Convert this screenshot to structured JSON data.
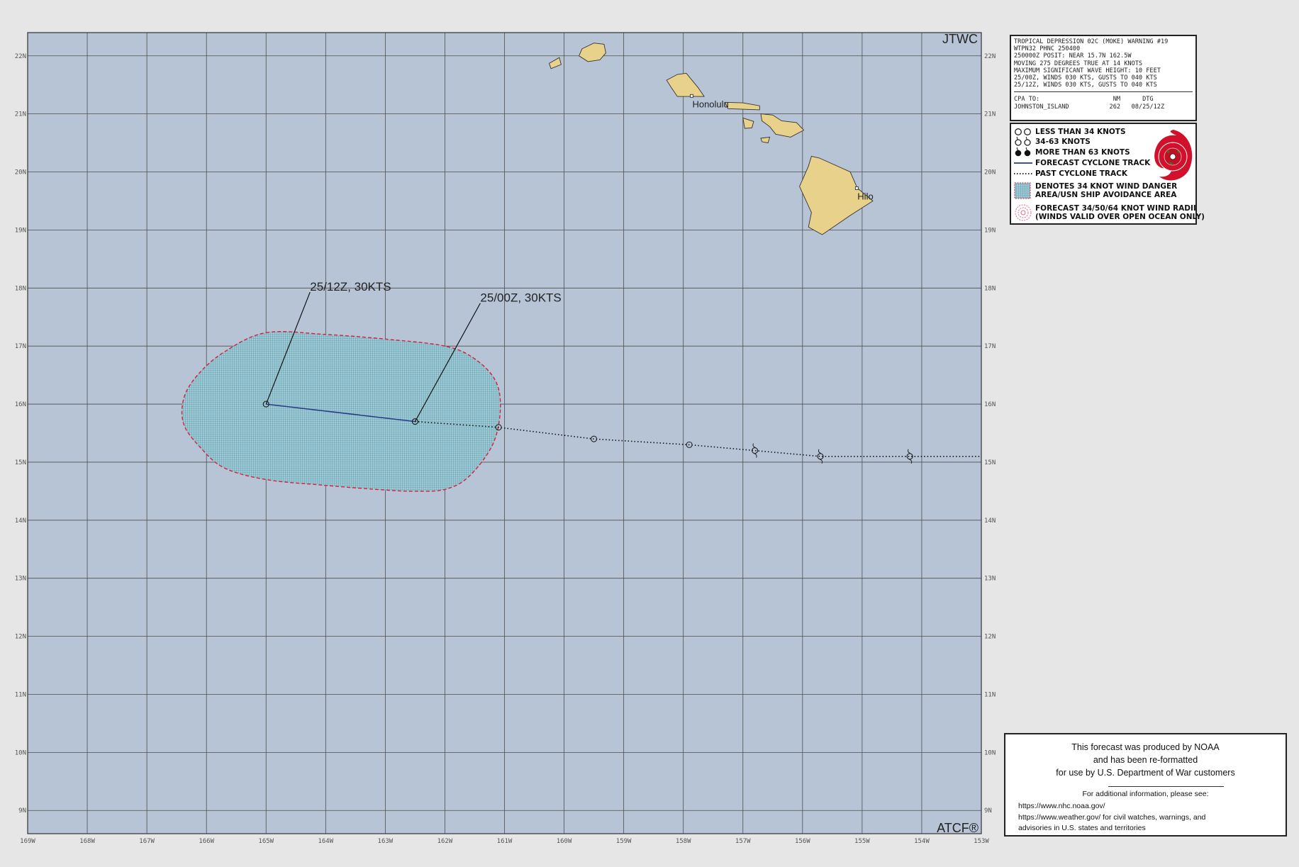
{
  "map": {
    "agency_label": "JTWC",
    "footer_label": "ATCF®",
    "lon_range": [
      -169,
      -153
    ],
    "lat_range": [
      8.6,
      22.4
    ],
    "lon_ticks": [
      "169W",
      "168W",
      "167W",
      "166W",
      "165W",
      "164W",
      "163W",
      "162W",
      "161W",
      "160W",
      "159W",
      "158W",
      "157W",
      "156W",
      "155W",
      "154W",
      "153W"
    ],
    "lat_ticks": [
      "22N",
      "21N",
      "20N",
      "19N",
      "18N",
      "17N",
      "16N",
      "15N",
      "14N",
      "13N",
      "12N",
      "11N",
      "10N",
      "9N"
    ],
    "places": [
      {
        "name": "Honolulu",
        "lon": -157.86,
        "lat": 21.31
      },
      {
        "name": "Hilo",
        "lon": -155.09,
        "lat": 19.72
      }
    ],
    "forecast_track": [
      {
        "label": "25/00Z,  30KTS",
        "lon": -162.5,
        "lat": 15.7
      },
      {
        "label": "25/12Z,  30KTS",
        "lon": -165.0,
        "lat": 16.0
      }
    ],
    "past_track": [
      {
        "lon": -161.1,
        "lat": 15.6,
        "intensity": "less-than-34"
      },
      {
        "lon": -159.5,
        "lat": 15.4,
        "intensity": "less-than-34"
      },
      {
        "lon": -157.9,
        "lat": 15.3,
        "intensity": "less-than-34"
      },
      {
        "lon": -156.8,
        "lat": 15.2,
        "intensity": "34-63"
      },
      {
        "lon": -155.7,
        "lat": 15.1,
        "intensity": "34-63"
      },
      {
        "lon": -154.2,
        "lat": 15.1,
        "intensity": "34-63"
      },
      {
        "lon": -153.0,
        "lat": 15.1,
        "intensity": "34-63"
      }
    ],
    "danger_area": [
      [
        -165.0,
        17.23
      ],
      [
        -164.0,
        17.2
      ],
      [
        -163.0,
        17.12
      ],
      [
        -162.0,
        17.0
      ],
      [
        -161.5,
        16.78
      ],
      [
        -161.15,
        16.4
      ],
      [
        -161.07,
        15.9
      ],
      [
        -161.2,
        15.3
      ],
      [
        -161.6,
        14.75
      ],
      [
        -162.0,
        14.53
      ],
      [
        -162.5,
        14.5
      ],
      [
        -163.0,
        14.52
      ],
      [
        -164.0,
        14.6
      ],
      [
        -165.0,
        14.7
      ],
      [
        -165.7,
        14.9
      ],
      [
        -166.1,
        15.25
      ],
      [
        -166.38,
        15.65
      ],
      [
        -166.38,
        16.1
      ],
      [
        -166.15,
        16.5
      ],
      [
        -165.7,
        16.9
      ]
    ],
    "islands": [
      {
        "name": "Niihau",
        "coords": [
          [
            -160.25,
            21.87
          ],
          [
            -160.08,
            21.97
          ],
          [
            -160.05,
            21.85
          ],
          [
            -160.22,
            21.78
          ]
        ]
      },
      {
        "name": "Kauai",
        "coords": [
          [
            -159.7,
            22.12
          ],
          [
            -159.5,
            22.22
          ],
          [
            -159.33,
            22.2
          ],
          [
            -159.3,
            22.05
          ],
          [
            -159.4,
            21.93
          ],
          [
            -159.6,
            21.9
          ],
          [
            -159.75,
            22.0
          ]
        ]
      },
      {
        "name": "Oahu",
        "coords": [
          [
            -158.28,
            21.58
          ],
          [
            -158.1,
            21.68
          ],
          [
            -157.95,
            21.7
          ],
          [
            -157.75,
            21.45
          ],
          [
            -157.65,
            21.3
          ],
          [
            -158.1,
            21.3
          ],
          [
            -158.2,
            21.45
          ]
        ]
      },
      {
        "name": "Molokai",
        "coords": [
          [
            -157.3,
            21.2
          ],
          [
            -157.0,
            21.19
          ],
          [
            -156.72,
            21.14
          ],
          [
            -156.72,
            21.07
          ],
          [
            -157.25,
            21.09
          ]
        ]
      },
      {
        "name": "Lanai",
        "coords": [
          [
            -157.0,
            20.93
          ],
          [
            -156.82,
            20.87
          ],
          [
            -156.85,
            20.76
          ],
          [
            -156.97,
            20.75
          ]
        ]
      },
      {
        "name": "Maui",
        "coords": [
          [
            -156.7,
            21.0
          ],
          [
            -156.5,
            20.98
          ],
          [
            -156.35,
            20.88
          ],
          [
            -156.1,
            20.85
          ],
          [
            -155.98,
            20.72
          ],
          [
            -156.2,
            20.6
          ],
          [
            -156.45,
            20.65
          ],
          [
            -156.55,
            20.78
          ],
          [
            -156.68,
            20.88
          ]
        ]
      },
      {
        "name": "Kahoolawe",
        "coords": [
          [
            -156.7,
            20.58
          ],
          [
            -156.55,
            20.6
          ],
          [
            -156.58,
            20.5
          ],
          [
            -156.68,
            20.52
          ]
        ]
      },
      {
        "name": "Hawaii",
        "coords": [
          [
            -155.85,
            20.27
          ],
          [
            -155.72,
            20.24
          ],
          [
            -155.2,
            20.0
          ],
          [
            -155.08,
            19.72
          ],
          [
            -154.82,
            19.5
          ],
          [
            -155.2,
            19.25
          ],
          [
            -155.67,
            18.92
          ],
          [
            -155.9,
            19.05
          ],
          [
            -155.85,
            19.3
          ],
          [
            -156.05,
            19.75
          ],
          [
            -155.9,
            20.1
          ]
        ]
      }
    ]
  },
  "colors": {
    "ocean": "#b6c4d6",
    "grid": "#4d4d4d",
    "land": "#e8d18a",
    "danger_fill": "#9fcad6",
    "danger_border": "#d1233a",
    "forecast_track": "#283a86"
  },
  "warning": {
    "lines": [
      "TROPICAL DEPRESSION 02C (MOKE) WARNING #19",
      "WTPN32 PHNC 250400",
      "250000Z POSIT: NEAR 15.7N 162.5W",
      "MOVING 275 DEGREES TRUE AT 14 KNOTS",
      "MAXIMUM SIGNIFICANT WAVE HEIGHT: 10 FEET",
      "25/00Z, WINDS 030 KTS, GUSTS TO 040 KTS",
      "25/12Z, WINDS 030 KTS, GUSTS TO 040 KTS"
    ],
    "cpa_header": "CPA TO:                    NM      DTG",
    "cpa_row": "JOHNSTON_ISLAND           262   08/25/12Z"
  },
  "legend": {
    "items": [
      {
        "icon": "less-than-34-knots-icon",
        "text": "LESS THAN 34 KNOTS"
      },
      {
        "icon": "34-63-knots-icon",
        "text": "34-63 KNOTS"
      },
      {
        "icon": "more-than-63-knots-icon",
        "text": "MORE THAN 63 KNOTS"
      },
      {
        "icon": "forecast-track-icon",
        "text": "FORECAST CYCLONE TRACK"
      },
      {
        "icon": "past-track-icon",
        "text": "PAST CYCLONE TRACK"
      },
      {
        "icon": "danger-area-icon",
        "text": "DENOTES 34 KNOT WIND DANGER\nAREA/USN SHIP AVOIDANCE AREA"
      },
      {
        "icon": "wind-radii-icon",
        "text": "FORECAST 34/50/64 KNOT WIND RADII\n(WINDS VALID OVER OPEN OCEAN ONLY)"
      }
    ]
  },
  "noaa": {
    "line1": "This forecast was produced by NOAA",
    "line2": "and has been re-formatted",
    "line3": "for use by U.S. Department of War customers",
    "info": "For additional information, please see:",
    "link1": "https://www.nhc.noaa.gov/",
    "link2": "https://www.weather.gov/ for civil watches, warnings, and",
    "link3": "advisories in U.S. states and territories"
  }
}
